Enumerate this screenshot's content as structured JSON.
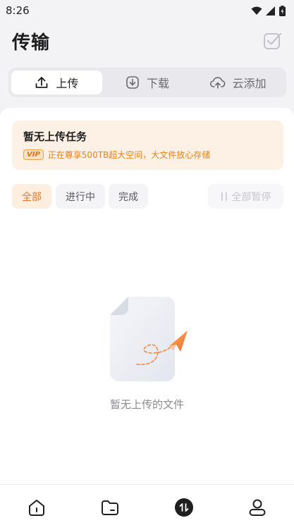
{
  "status_bar": {
    "time": "8:26"
  },
  "header": {
    "title": "传输"
  },
  "tabs": [
    {
      "label": "上传",
      "icon": "upload-icon",
      "active": true
    },
    {
      "label": "下载",
      "icon": "download-icon",
      "active": false
    },
    {
      "label": "云添加",
      "icon": "cloud-add-icon",
      "active": false
    }
  ],
  "banner": {
    "title": "暂无上传任务",
    "badge": "VIP",
    "subtitle": "正在尊享500TB超大空间，大文件放心存储"
  },
  "filters": [
    {
      "label": "全部",
      "active": true
    },
    {
      "label": "进行中",
      "active": false
    },
    {
      "label": "完成",
      "active": false
    }
  ],
  "pause_all": {
    "label": "全部暂停",
    "enabled": false
  },
  "empty_state": {
    "text": "暂无上传的文件"
  },
  "bottom_nav": [
    {
      "icon": "home-icon"
    },
    {
      "icon": "folder-icon"
    },
    {
      "icon": "transfer-icon",
      "active": true
    },
    {
      "icon": "profile-icon"
    }
  ],
  "colors": {
    "accent": "#e8782a",
    "vip": "#e8811f"
  }
}
